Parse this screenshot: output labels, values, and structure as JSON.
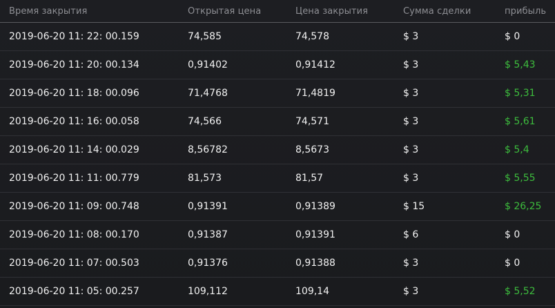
{
  "header": {
    "close_time": "Время закрытия",
    "open_price": "Открытая цена",
    "close_price": "Цена закрытия",
    "amount": "Сумма сделки",
    "profit": "прибыль"
  },
  "colors": {
    "positive_profit": "#3dbd3d",
    "neutral_profit": "#f2f2f2"
  },
  "rows": [
    {
      "time": "2019-06-20 11: 22: 00.159",
      "open": "74,585",
      "close": "74,578",
      "amount": "$ 3",
      "profit": "$ 0",
      "positive": false
    },
    {
      "time": "2019-06-20 11: 20: 00.134",
      "open": "0,91402",
      "close": "0,91412",
      "amount": "$ 3",
      "profit": "$ 5,43",
      "positive": true
    },
    {
      "time": "2019-06-20 11: 18: 00.096",
      "open": "71,4768",
      "close": "71,4819",
      "amount": "$ 3",
      "profit": "$ 5,31",
      "positive": true
    },
    {
      "time": "2019-06-20 11: 16: 00.058",
      "open": "74,566",
      "close": "74,571",
      "amount": "$ 3",
      "profit": "$ 5,61",
      "positive": true
    },
    {
      "time": "2019-06-20 11: 14: 00.029",
      "open": "8,56782",
      "close": "8,5673",
      "amount": "$ 3",
      "profit": "$ 5,4",
      "positive": true
    },
    {
      "time": "2019-06-20 11: 11: 00.779",
      "open": "81,573",
      "close": "81,57",
      "amount": "$ 3",
      "profit": "$ 5,55",
      "positive": true
    },
    {
      "time": "2019-06-20 11: 09: 00.748",
      "open": "0,91391",
      "close": "0,91389",
      "amount": "$ 15",
      "profit": "$ 26,25",
      "positive": true
    },
    {
      "time": "2019-06-20 11: 08: 00.170",
      "open": "0,91387",
      "close": "0,91391",
      "amount": "$ 6",
      "profit": "$ 0",
      "positive": false
    },
    {
      "time": "2019-06-20 11: 07: 00.503",
      "open": "0,91376",
      "close": "0,91388",
      "amount": "$ 3",
      "profit": "$ 0",
      "positive": false
    },
    {
      "time": "2019-06-20 11: 05: 00.257",
      "open": "109,112",
      "close": "109,14",
      "amount": "$ 3",
      "profit": "$ 5,52",
      "positive": true
    }
  ]
}
